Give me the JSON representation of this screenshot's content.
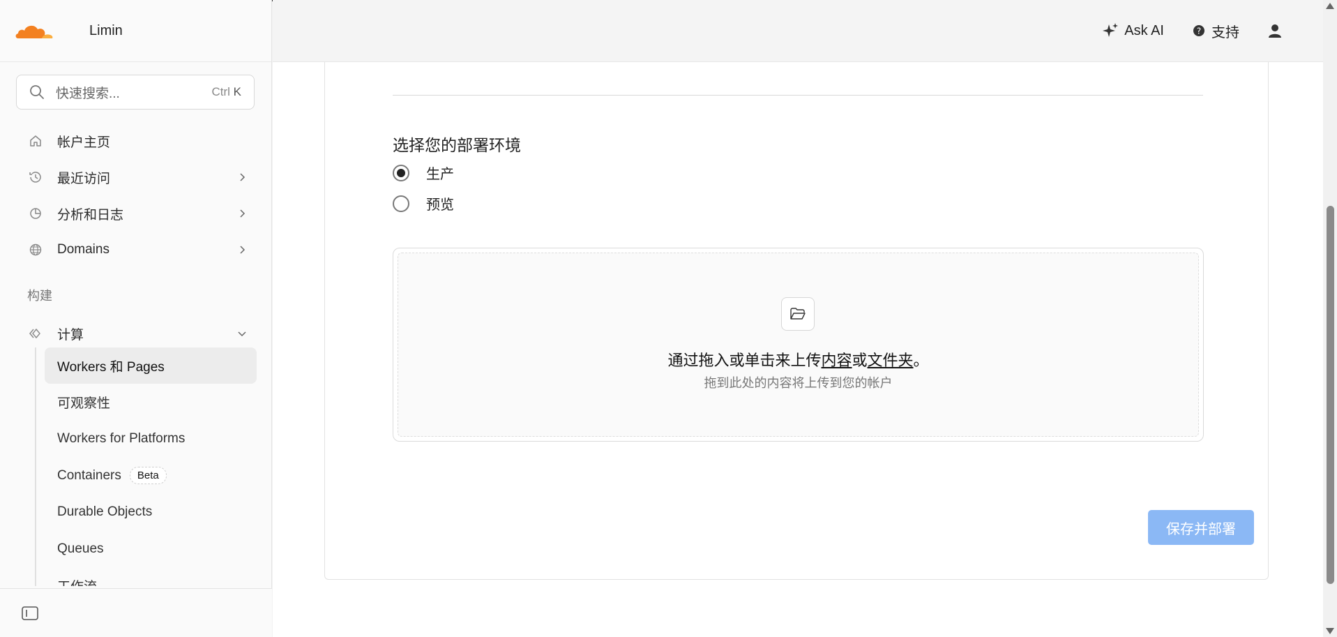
{
  "account": {
    "name": "Limin"
  },
  "search": {
    "placeholder": "快速搜索...",
    "shortcut_ctrl": "Ctrl",
    "shortcut_key": "K"
  },
  "nav": {
    "items": [
      {
        "label": "帐户主页",
        "icon": "home-icon",
        "chevron": false
      },
      {
        "label": "最近访问",
        "icon": "clock-icon",
        "chevron": true
      },
      {
        "label": "分析和日志",
        "icon": "pie-chart-icon",
        "chevron": true
      },
      {
        "label": "Domains",
        "icon": "globe-icon",
        "chevron": true
      }
    ],
    "section_label": "构建",
    "compute": {
      "label": "计算",
      "icon": "code-icon",
      "expanded": true
    },
    "sub_items": [
      {
        "label": "Workers 和 Pages",
        "active": true
      },
      {
        "label": "可观察性"
      },
      {
        "label": "Workers for Platforms"
      },
      {
        "label": "Containers",
        "badge": "Beta"
      },
      {
        "label": "Durable Objects"
      },
      {
        "label": "Queues"
      },
      {
        "label": "工作流"
      }
    ]
  },
  "header": {
    "ask_ai": "Ask AI",
    "support": "支持"
  },
  "deploy": {
    "env_title": "选择您的部署环境",
    "options": [
      {
        "label": "生产",
        "selected": true
      },
      {
        "label": "预览",
        "selected": false
      }
    ],
    "dropzone": {
      "text_prefix": "通过拖入或单击来上传",
      "link_content": "内容",
      "text_or": "或",
      "link_folder": "文件夹",
      "text_suffix": "。",
      "subtext": "拖到此处的内容将上传到您的帐户"
    },
    "save_button": "保存并部署"
  },
  "colors": {
    "accent": "#f38020",
    "button_disabled": "#8bb8f5"
  }
}
